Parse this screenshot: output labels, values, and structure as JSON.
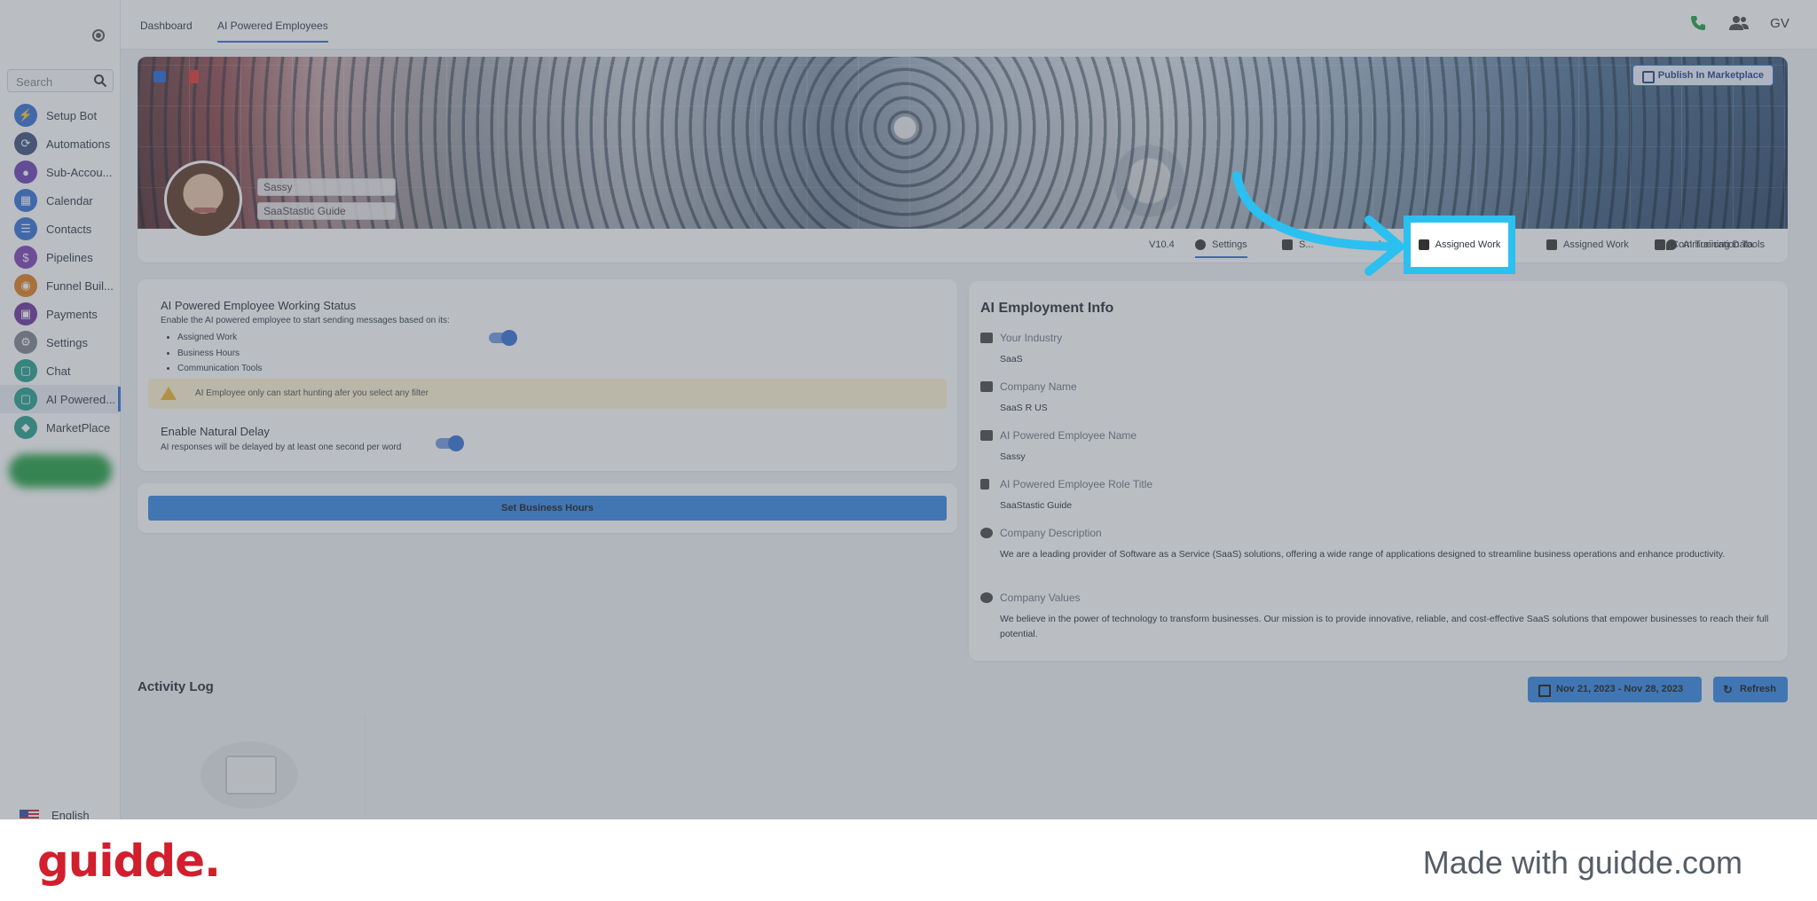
{
  "topbar": {
    "tabs": [
      "Dashboard",
      "AI Powered Employees"
    ],
    "avatar_initials": "GV"
  },
  "sidebar": {
    "search_placeholder": "Search",
    "items": [
      {
        "label": "Setup Bot",
        "icon": "bolt-icon",
        "color": "#2f6fd6"
      },
      {
        "label": "Automations",
        "icon": "automation-icon",
        "color": "#3a4f7a"
      },
      {
        "label": "Sub-Accou...",
        "icon": "user-icon",
        "color": "#6a3fb5"
      },
      {
        "label": "Calendar",
        "icon": "calendar-icon",
        "color": "#2f6fd6"
      },
      {
        "label": "Contacts",
        "icon": "contacts-icon",
        "color": "#2f6fd6"
      },
      {
        "label": "Pipelines",
        "icon": "pipeline-icon",
        "color": "#7b3fb5"
      },
      {
        "label": "Funnel Buil...",
        "icon": "funnel-icon",
        "color": "#e07b17"
      },
      {
        "label": "Payments",
        "icon": "card-icon",
        "color": "#6a2f9e"
      },
      {
        "label": "Settings",
        "icon": "gear-icon",
        "color": "#7a828c"
      },
      {
        "label": "Chat",
        "icon": "chat-icon",
        "color": "#1f9e8a"
      },
      {
        "label": "AI Powered...",
        "icon": "ai-chat-icon",
        "color": "#1f9e8a"
      },
      {
        "label": "MarketPlace",
        "icon": "marketplace-icon",
        "color": "#1f9e8a"
      }
    ],
    "language": "English"
  },
  "profile": {
    "name": "Sassy",
    "role": "SaaStastic Guide",
    "publish_label": "Publish In Marketplace"
  },
  "tabstrip": {
    "version": "V10.4",
    "tabs": [
      "Settings",
      "S...",
      "...ode",
      "Assigned Work",
      "AI Training Data",
      "Communication Tools"
    ]
  },
  "status_card": {
    "title": "AI Powered Employee Working Status",
    "description": "Enable the AI powered employee to start sending messages based on its:",
    "bullets": [
      "Assigned Work",
      "Business Hours",
      "Communication Tools"
    ],
    "warning": "AI Employee only can start hunting afer you select any filter",
    "delay_title": "Enable Natural Delay",
    "delay_description": "AI responses will be delayed by at least one second per word"
  },
  "hours_button": "Set Business Hours",
  "info": {
    "title": "AI Employment Info",
    "rows": [
      {
        "label": "Your Industry",
        "value": "SaaS",
        "icon": "factory-icon"
      },
      {
        "label": "Company Name",
        "value": "SaaS R US",
        "icon": "building-icon"
      },
      {
        "label": "AI Powered Employee Name",
        "value": "Sassy",
        "icon": "briefcase-icon"
      },
      {
        "label": "AI Powered Employee Role Title",
        "value": "SaaStastic Guide",
        "icon": "flag-icon"
      },
      {
        "label": "Company Description",
        "value": "We are a leading provider of Software as a Service (SaaS) solutions, offering a wide range of applications designed to streamline business operations and enhance productivity.",
        "icon": "info-icon"
      },
      {
        "label": "Company Values",
        "value": "We believe in the power of technology to transform businesses. Our mission is to provide innovative, reliable, and cost-effective SaaS solutions that empower businesses to reach their full potential.",
        "icon": "info-icon"
      }
    ]
  },
  "activity": {
    "title": "Activity Log",
    "date_range": "Nov 21, 2023 - Nov 28, 2023",
    "refresh": "Refresh"
  },
  "footer": {
    "brand": "guidde.",
    "made_with": "Made with guidde.com"
  },
  "colors": {
    "accent": "#2f6fd6",
    "highlight": "#2bc0ef",
    "brand": "#d11f2e",
    "warning_bg": "#fff4d2"
  }
}
